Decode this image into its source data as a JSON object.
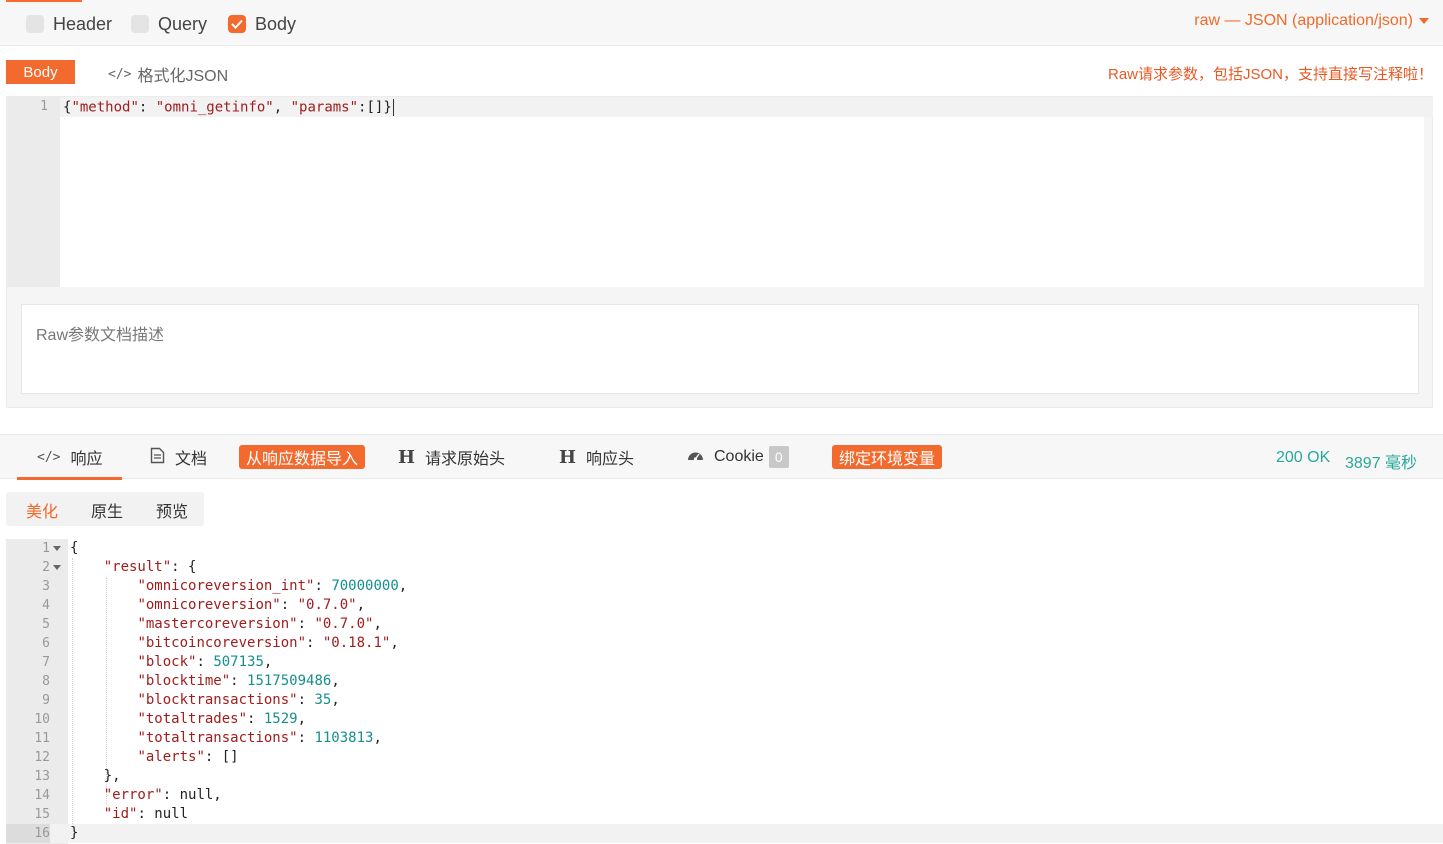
{
  "params_tabs": [
    {
      "label": "Header",
      "checked": false
    },
    {
      "label": "Query",
      "checked": false
    },
    {
      "label": "Body",
      "checked": true
    }
  ],
  "body_mode": "raw — JSON (application/json)",
  "body_toolbar": {
    "body_tag": "Body",
    "format_json": "格式化JSON",
    "hint": "Raw请求参数，包括JSON，支持直接写注释啦！"
  },
  "request_editor": {
    "line_number": "1",
    "tokens": {
      "open": "{",
      "k1": "\"method\"",
      "sep1": ": ",
      "v1": "\"omni_getinfo\"",
      "sep2": ", ",
      "k2": "\"params\"",
      "sep3": ":[]}"
    }
  },
  "description_placeholder": "Raw参数文档描述",
  "response_tabs": {
    "response": "响应",
    "docs": "文档",
    "import": "从响应数据导入",
    "raw_request_headers": "请求原始头",
    "response_headers": "响应头",
    "cookie": "Cookie",
    "cookie_count": "0",
    "bind_env": "绑定环境变量",
    "status": "200 OK",
    "time": "3897 毫秒"
  },
  "view_tabs": {
    "beautify": "美化",
    "raw": "原生",
    "preview": "预览"
  },
  "response_lines": [
    {
      "n": "1",
      "fold": true,
      "parts": [
        [
          "p",
          "{"
        ]
      ]
    },
    {
      "n": "2",
      "fold": true,
      "parts": [
        [
          "p",
          "    "
        ],
        [
          "k",
          "\"result\""
        ],
        [
          "p",
          ": {"
        ]
      ]
    },
    {
      "n": "3",
      "parts": [
        [
          "p",
          "        "
        ],
        [
          "k",
          "\"omnicoreversion_int\""
        ],
        [
          "p",
          ": "
        ],
        [
          "n",
          "70000000"
        ],
        [
          "p",
          ","
        ]
      ]
    },
    {
      "n": "4",
      "parts": [
        [
          "p",
          "        "
        ],
        [
          "k",
          "\"omnicoreversion\""
        ],
        [
          "p",
          ": "
        ],
        [
          "s",
          "\"0.7.0\""
        ],
        [
          "p",
          ","
        ]
      ]
    },
    {
      "n": "5",
      "parts": [
        [
          "p",
          "        "
        ],
        [
          "k",
          "\"mastercoreversion\""
        ],
        [
          "p",
          ": "
        ],
        [
          "s",
          "\"0.7.0\""
        ],
        [
          "p",
          ","
        ]
      ]
    },
    {
      "n": "6",
      "parts": [
        [
          "p",
          "        "
        ],
        [
          "k",
          "\"bitcoincoreversion\""
        ],
        [
          "p",
          ": "
        ],
        [
          "s",
          "\"0.18.1\""
        ],
        [
          "p",
          ","
        ]
      ]
    },
    {
      "n": "7",
      "parts": [
        [
          "p",
          "        "
        ],
        [
          "k",
          "\"block\""
        ],
        [
          "p",
          ": "
        ],
        [
          "n",
          "507135"
        ],
        [
          "p",
          ","
        ]
      ]
    },
    {
      "n": "8",
      "parts": [
        [
          "p",
          "        "
        ],
        [
          "k",
          "\"blocktime\""
        ],
        [
          "p",
          ": "
        ],
        [
          "n",
          "1517509486"
        ],
        [
          "p",
          ","
        ]
      ]
    },
    {
      "n": "9",
      "parts": [
        [
          "p",
          "        "
        ],
        [
          "k",
          "\"blocktransactions\""
        ],
        [
          "p",
          ": "
        ],
        [
          "n",
          "35"
        ],
        [
          "p",
          ","
        ]
      ]
    },
    {
      "n": "10",
      "parts": [
        [
          "p",
          "        "
        ],
        [
          "k",
          "\"totaltrades\""
        ],
        [
          "p",
          ": "
        ],
        [
          "n",
          "1529"
        ],
        [
          "p",
          ","
        ]
      ]
    },
    {
      "n": "11",
      "parts": [
        [
          "p",
          "        "
        ],
        [
          "k",
          "\"totaltransactions\""
        ],
        [
          "p",
          ": "
        ],
        [
          "n",
          "1103813"
        ],
        [
          "p",
          ","
        ]
      ]
    },
    {
      "n": "12",
      "parts": [
        [
          "p",
          "        "
        ],
        [
          "k",
          "\"alerts\""
        ],
        [
          "p",
          ": []"
        ]
      ]
    },
    {
      "n": "13",
      "parts": [
        [
          "p",
          "    },"
        ]
      ]
    },
    {
      "n": "14",
      "parts": [
        [
          "p",
          "    "
        ],
        [
          "k",
          "\"error\""
        ],
        [
          "p",
          ": null,"
        ]
      ]
    },
    {
      "n": "15",
      "parts": [
        [
          "p",
          "    "
        ],
        [
          "k",
          "\"id\""
        ],
        [
          "p",
          ": null"
        ]
      ]
    },
    {
      "n": "16",
      "active": true,
      "parts": [
        [
          "p",
          "}"
        ]
      ]
    }
  ],
  "colors": {
    "accent": "#f26a2e",
    "json_key": "#a11d1d",
    "json_number": "#168e8e",
    "status_ok": "#29a89a"
  }
}
